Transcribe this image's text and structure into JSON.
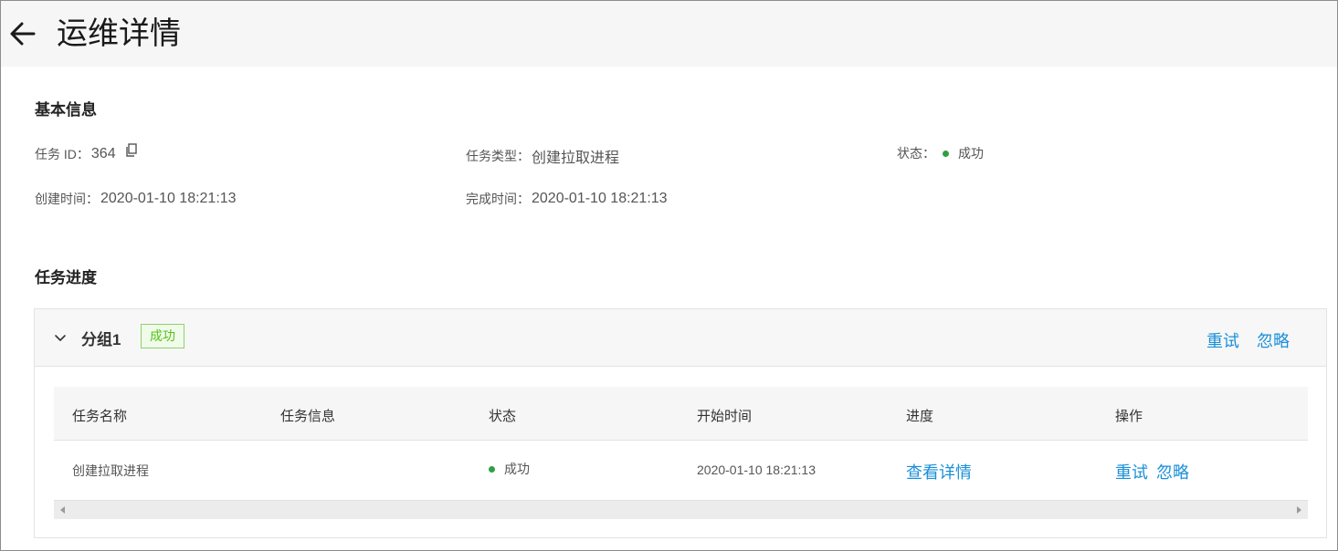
{
  "header": {
    "title": "运维详情"
  },
  "basic_info": {
    "section_title": "基本信息",
    "task_id_label": "任务 ID：",
    "task_id_value": "364",
    "task_type_label": "任务类型：",
    "task_type_value": "创建拉取进程",
    "status_label": "状态：",
    "status_value": "成功",
    "created_label": "创建时间：",
    "created_value": "2020-01-10 18:21:13",
    "finished_label": "完成时间：",
    "finished_value": "2020-01-10 18:21:13"
  },
  "progress": {
    "section_title": "任务进度",
    "group": {
      "name": "分组1",
      "status_tag": "成功",
      "retry_label": "重试",
      "ignore_label": "忽略"
    },
    "table": {
      "columns": [
        "任务名称",
        "任务信息",
        "状态",
        "开始时间",
        "进度",
        "操作"
      ],
      "rows": [
        {
          "name": "创建拉取进程",
          "info": "",
          "status": "成功",
          "start_time": "2020-01-10 18:21:13",
          "progress_link": "查看详情",
          "retry_label": "重试",
          "ignore_label": "忽略"
        }
      ]
    }
  },
  "colors": {
    "success": "#2ea043",
    "link": "#1a8fd9",
    "tag_border": "#8fd16f"
  },
  "icons": [
    "arrow-left-icon",
    "copy-icon",
    "chevron-down-icon",
    "scroll-left-icon",
    "scroll-right-icon"
  ]
}
